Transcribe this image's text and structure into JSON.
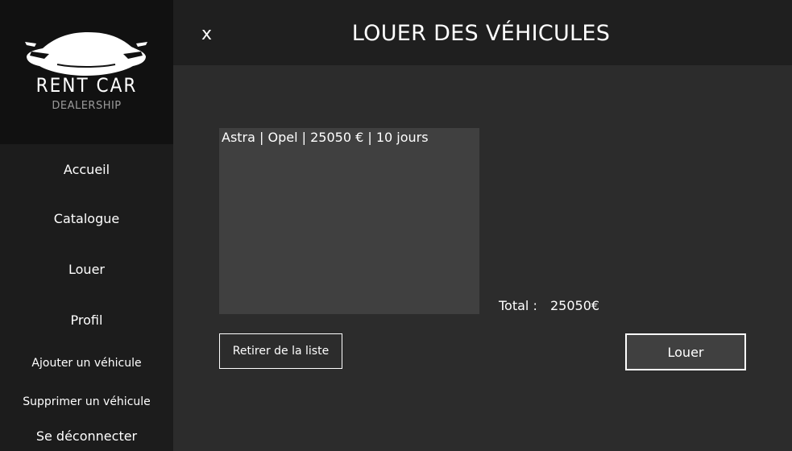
{
  "window": {
    "title": "LOUER DES VÉHICULES",
    "close_label": "x"
  },
  "logo": {
    "title": "RENT CAR",
    "subtitle": "DEALERSHIP",
    "icon": "car-silhouette-icon"
  },
  "sidebar": {
    "items": [
      {
        "label": "Accueil"
      },
      {
        "label": "Catalogue"
      },
      {
        "label": "Louer"
      },
      {
        "label": "Profil"
      },
      {
        "label": "Ajouter un véhicule"
      },
      {
        "label": "Supprimer un véhicule"
      },
      {
        "label": "Se déconnecter"
      }
    ]
  },
  "rental_list": {
    "items": [
      {
        "text": "Astra | Opel | 25050 € | 10 jours"
      }
    ]
  },
  "total": {
    "label": "Total :",
    "value": "25050€"
  },
  "actions": {
    "remove_label": "Retirer de la liste",
    "rent_label": "Louer"
  },
  "colors": {
    "background": "#2c2c2c",
    "sidebar": "#1c1c1c",
    "logo_area": "#111111",
    "header": "#1f1f1f",
    "list_background": "#404040",
    "text": "#ffffff"
  }
}
